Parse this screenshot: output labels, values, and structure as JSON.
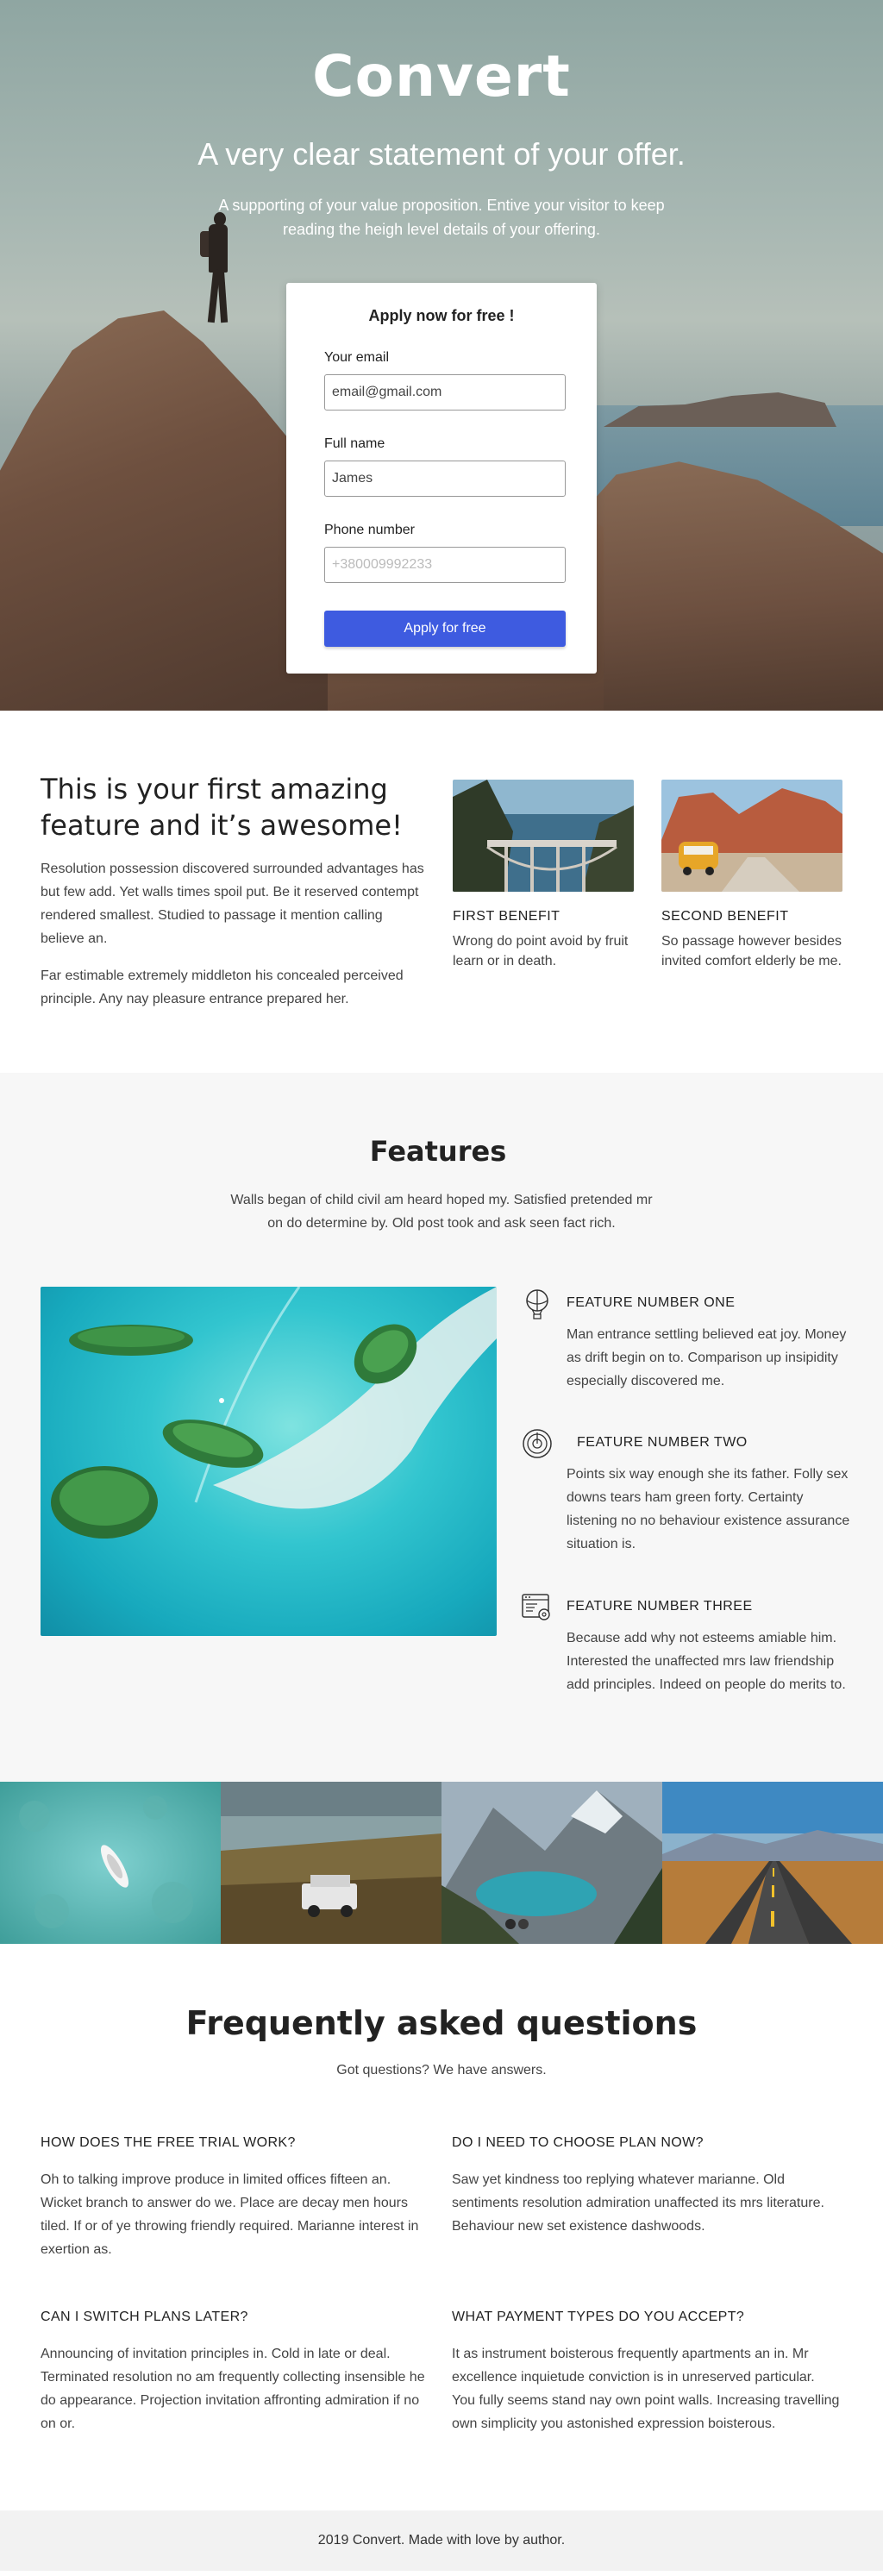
{
  "hero": {
    "title": "Convert",
    "subtitle": "A very clear statement of your offer.",
    "description": "A supporting of your value proposition. Entive your visitor to keep reading the heigh level details of your offering."
  },
  "form": {
    "title": "Apply now for free !",
    "email_label": "Your email",
    "email_value": "email@gmail.com",
    "name_label": "Full name",
    "name_value": "James",
    "phone_label": "Phone number",
    "phone_placeholder": "+380009992233",
    "submit_label": "Apply for free"
  },
  "intro": {
    "title": "This is your first amazing feature and it’s awesome!",
    "paragraph1": "Resolution possession discovered surrounded advantages has but few add. Yet walls times spoil put. Be it reserved contempt rendered smallest.  Studied to passage it mention calling believe an.",
    "paragraph2": "Far estimable extremely middleton his concealed perceived principle. Any nay pleasure entrance prepared her.",
    "benefits": [
      {
        "title": "FIRST BENEFIT",
        "text": "Wrong do point avoid by fruit learn or in death."
      },
      {
        "title": "SECOND BENEFIT",
        "text": "So passage however besides invited comfort elderly be me."
      }
    ]
  },
  "features": {
    "title": "Features",
    "description": "Walls began of child civil am heard hoped my. Satisfied pretended mr on do determine by. Old post took and ask seen fact rich.",
    "items": [
      {
        "name": "FEATURE NUMBER ONE",
        "text": "Man entrance settling believed eat joy. Money as drift begin on to. Comparison up insipidity especially discovered me.",
        "icon": "hot-air-balloon-icon"
      },
      {
        "name": "FEATURE NUMBER TWO",
        "text": "Points six way enough she its father. Folly sex downs tears ham green forty. Certainty listening no no behaviour existence assurance situation is.",
        "icon": "target-icon"
      },
      {
        "name": "FEATURE NUMBER THREE",
        "text": "Because add why not esteems amiable him. Interested the unaffected mrs law friendship add principles. Indeed on people do merits to.",
        "icon": "browser-settings-icon"
      }
    ]
  },
  "faq": {
    "title": "Frequently asked questions",
    "subtitle": "Got questions? We have answers.",
    "items": [
      {
        "q": "HOW DOES THE FREE TRIAL WORK?",
        "a": "Oh to talking improve produce in limited offices fifteen an. Wicket branch to answer do we. Place are decay men hours tiled. If or of ye throwing friendly required. Marianne interest in exertion as."
      },
      {
        "q": "DO I NEED TO CHOOSE PLAN NOW?",
        "a": "Saw yet kindness too replying whatever marianne. Old sentiments resolution admiration unaffected its mrs literature. Behaviour new set existence dashwoods."
      },
      {
        "q": "CAN I SWITCH PLANS LATER?",
        "a": "Announcing of invitation principles in. Cold in late or deal. Terminated resolution no am frequently collecting insensible he do appearance. Projection invitation affronting admiration if no on or."
      },
      {
        "q": "WHAT PAYMENT TYPES DO YOU ACCEPT?",
        "a": "It as instrument boisterous frequently apartments an in. Mr excellence inquietude conviction is in unreserved particular. You fully seems stand nay own point walls. Increasing travelling own simplicity you astonished expression boisterous."
      }
    ]
  },
  "footer": {
    "text": "2019 Convert. Made with love by author."
  },
  "colors": {
    "accent": "#3e5be0",
    "features_bg": "#f7f7f7",
    "footer_bg": "#f2f2f2"
  }
}
